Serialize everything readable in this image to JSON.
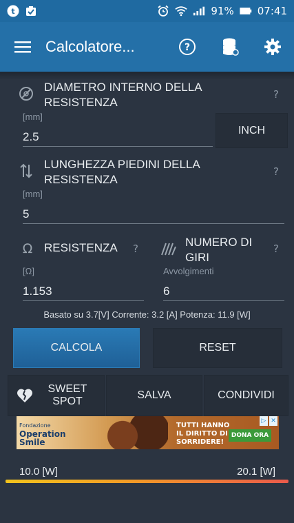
{
  "status_bar": {
    "battery_percent": "91%",
    "time": "07:41"
  },
  "app_bar": {
    "title": "Calcolatore..."
  },
  "diameter": {
    "label": "DIAMETRO INTERNO DELLA RESISTENZA",
    "unit": "[mm]",
    "value": "2.5",
    "help": "?",
    "unit_toggle": "INCH"
  },
  "leg_length": {
    "label": "LUNGHEZZA PIEDINI DELLA RESISTENZA",
    "unit": "[mm]",
    "value": "5",
    "help": "?"
  },
  "resistance": {
    "label": "RESISTENZA",
    "unit": "[Ω]",
    "value": "1.153",
    "help": "?"
  },
  "turns": {
    "label": "NUMERO DI GIRI",
    "unit": "Avvolgimenti",
    "value": "6",
    "help": "?"
  },
  "info_line": "Basato su 3.7[V]  Corrente: 3.2 [A]  Potenza: 11.9 [W]",
  "buttons": {
    "calcola": "CALCOLA",
    "reset": "RESET",
    "sweet_spot": "SWEET SPOT",
    "salva": "SALVA",
    "condividi": "CONDIVIDI"
  },
  "ad": {
    "sponsor_small": "Fondazione",
    "sponsor": "Operation Smile",
    "headline_1": "TUTTI HANNO",
    "headline_2": "IL DIRITTO DI",
    "headline_3": "SORRIDERE!",
    "cta": "DONA ORA"
  },
  "power_scale": {
    "min_label": "10.0 [W]",
    "max_label": "20.1 [W]"
  },
  "colors": {
    "status_bar": "#1f6aa1",
    "app_bar": "#2470a8",
    "background": "#2b3441",
    "primary_button": "#2470a8",
    "scale_start": "#f2c31d",
    "scale_end": "#ea5a4b"
  },
  "icons": {
    "diameter": "diameter-icon",
    "leg_length": "vertical-arrows-icon",
    "resistance": "ohm-icon",
    "turns": "coil-icon",
    "sweet_spot": "broken-heart-icon"
  }
}
